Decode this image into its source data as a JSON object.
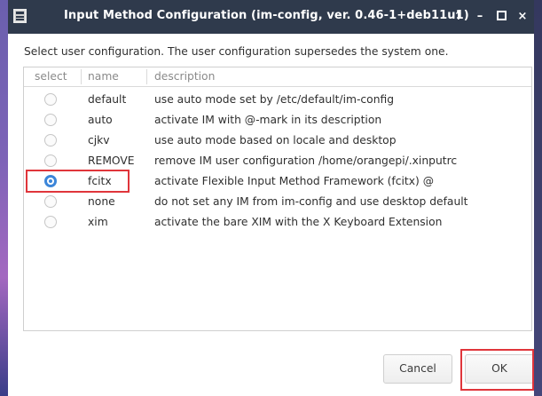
{
  "window": {
    "title": "Input Method Configuration (im-config, ver. 0.46-1+deb11u1)",
    "controls": {
      "keep_above": "↑",
      "minimize": "–",
      "close": "×"
    }
  },
  "instruction": "Select user configuration. The user configuration supersedes the system one.",
  "table": {
    "columns": [
      "select",
      "name",
      "description"
    ],
    "rows": [
      {
        "name": "default",
        "description": "use auto mode set by /etc/default/im-config",
        "selected": false
      },
      {
        "name": "auto",
        "description": "activate IM with @-mark in its description",
        "selected": false
      },
      {
        "name": "cjkv",
        "description": "use auto mode based on locale and desktop",
        "selected": false
      },
      {
        "name": "REMOVE",
        "description": "remove IM user configuration /home/orangepi/.xinputrc",
        "selected": false
      },
      {
        "name": "fcitx",
        "description": "activate Flexible Input Method Framework (fcitx) @",
        "selected": true
      },
      {
        "name": "none",
        "description": "do not set any IM from im-config and use desktop default",
        "selected": false
      },
      {
        "name": "xim",
        "description": "activate the bare XIM with the X Keyboard Extension",
        "selected": false
      }
    ]
  },
  "buttons": {
    "cancel": "Cancel",
    "ok": "OK"
  },
  "colors": {
    "titlebar": "#2f3a4c",
    "selection_accent": "#3c86d9",
    "highlight_annotation": "#e0353b"
  }
}
